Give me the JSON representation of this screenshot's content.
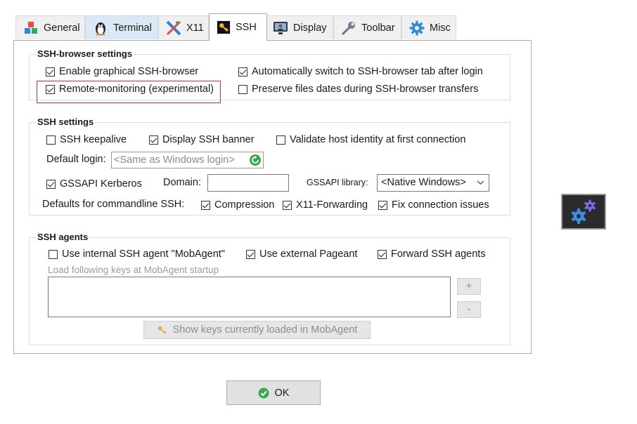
{
  "tabs": [
    {
      "label": "General",
      "icon": "colored-cubes-icon"
    },
    {
      "label": "Terminal",
      "icon": "penguin-icon"
    },
    {
      "label": "X11",
      "icon": "x11-logo-icon"
    },
    {
      "label": "SSH",
      "icon": "key-icon"
    },
    {
      "label": "Display",
      "icon": "monitor-user-icon"
    },
    {
      "label": "Toolbar",
      "icon": "wrench-icon"
    },
    {
      "label": "Misc",
      "icon": "gear-icon"
    }
  ],
  "active_tab": "SSH",
  "ssh_browser": {
    "title": "SSH-browser settings",
    "enable_browser": {
      "label": "Enable graphical SSH-browser",
      "checked": true
    },
    "auto_switch": {
      "label": "Automatically switch to SSH-browser tab after login",
      "checked": true
    },
    "remote_monitoring": {
      "label": "Remote-monitoring (experimental)",
      "checked": true
    },
    "preserve_dates": {
      "label": "Preserve files dates during SSH-browser transfers",
      "checked": false
    }
  },
  "ssh_settings": {
    "title": "SSH settings",
    "keepalive": {
      "label": "SSH keepalive",
      "checked": false
    },
    "display_banner": {
      "label": "Display SSH banner",
      "checked": true
    },
    "validate_host": {
      "label": "Validate host identity at first connection",
      "checked": false
    },
    "default_login_label": "Default login:",
    "default_login_placeholder": "<Same as Windows login>",
    "gssapi": {
      "label": "GSSAPI Kerberos",
      "checked": true
    },
    "domain_label": "Domain:",
    "domain_value": "",
    "gssapi_library_label": "GSSAPI library:",
    "gssapi_library_value": "<Native Windows>",
    "defaults_label": "Defaults for commandline SSH:",
    "compression": {
      "label": "Compression",
      "checked": true
    },
    "x11_forwarding": {
      "label": "X11-Forwarding",
      "checked": true
    },
    "fix_connection": {
      "label": "Fix connection issues",
      "checked": true
    }
  },
  "ssh_agents": {
    "title": "SSH agents",
    "internal_agent": {
      "label": "Use internal SSH agent \"MobAgent\"",
      "checked": false
    },
    "external_pageant": {
      "label": "Use external Pageant",
      "checked": true
    },
    "forward_agents": {
      "label": "Forward SSH agents",
      "checked": true
    },
    "keys_label": "Load following keys at MobAgent startup",
    "add_label": "+",
    "remove_label": "-",
    "show_keys_label": "Show keys currently loaded in MobAgent"
  },
  "ok_label": "OK",
  "colors": {
    "highlight": "#e03030",
    "settings_badge_bg": "#2b2b2b",
    "gear_blue": "#3b8fe0",
    "gear_purple": "#7a6be8"
  }
}
